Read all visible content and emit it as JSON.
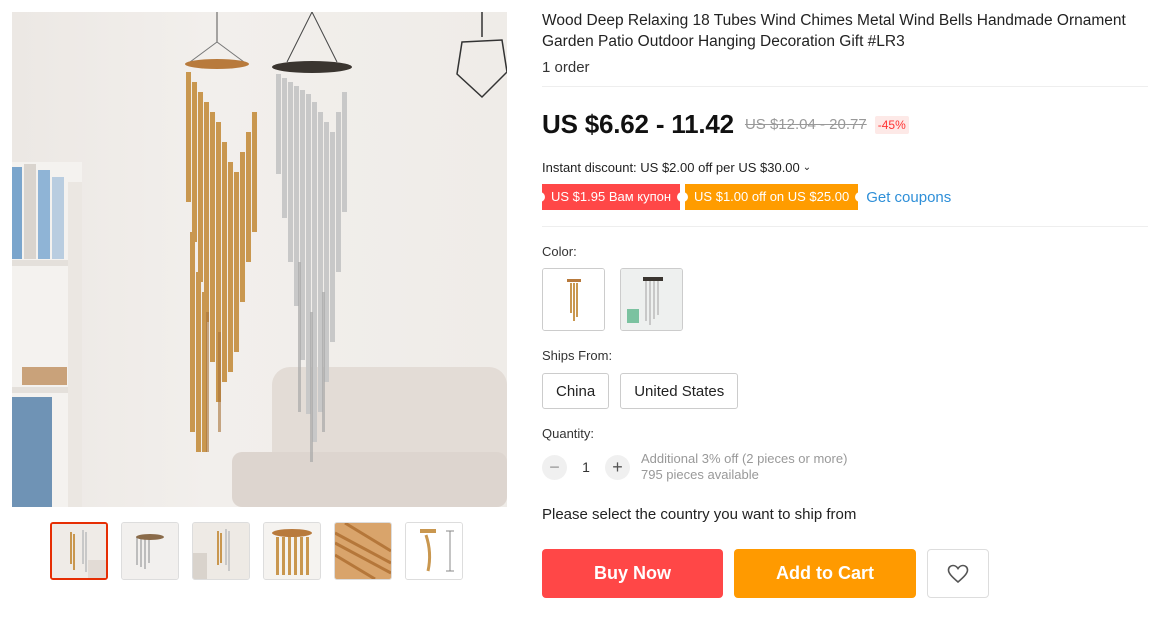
{
  "product": {
    "title": "Wood Deep Relaxing 18 Tubes Wind Chimes Metal Wind Bells Handmade Ornament Garden Patio Outdoor Hanging Decoration Gift #LR3",
    "orders": "1 order"
  },
  "price": {
    "current": "US $6.62 - 11.42",
    "original": "US $12.04 - 20.77",
    "discount": "-45%"
  },
  "promo": {
    "instant_discount": "Instant discount: US $2.00 off per US $30.00",
    "coupon_store": "US $1.95 Вам купон",
    "coupon_select": "US $1.00 off on US $25.00",
    "get_coupons": "Get coupons"
  },
  "options": {
    "color_label": "Color:",
    "ships_from_label": "Ships From:",
    "ships_from": [
      "China",
      "United States"
    ],
    "quantity_label": "Quantity:",
    "quantity_value": "1",
    "quantity_note_1": "Additional 3% off (2 pieces or more)",
    "quantity_note_2": "795 pieces available",
    "ship_message": "Please select the country you want to ship from"
  },
  "actions": {
    "buy_now": "Buy Now",
    "add_to_cart": "Add to Cart",
    "wishlist_icon": "heart-icon"
  },
  "colors": {
    "buy_now_bg": "#ff4747",
    "add_to_cart_bg": "#ff9a00",
    "link": "#2e8fd8",
    "discount_text": "#ff3333"
  },
  "gallery": {
    "thumbnail_count": 6,
    "active_thumbnail": 1
  }
}
